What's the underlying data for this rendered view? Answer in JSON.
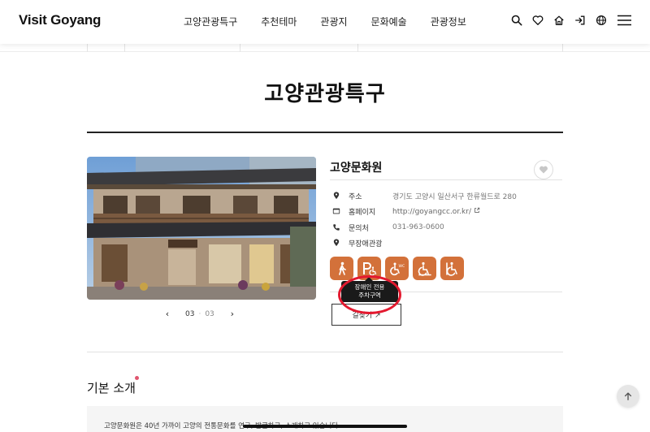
{
  "header": {
    "logo": "Visit Goyang",
    "nav": [
      "고양관광특구",
      "추천테마",
      "관광지",
      "문화예술",
      "관광정보"
    ]
  },
  "icons": {
    "search": "search-icon",
    "like": "heart-icon",
    "home": "home-icon",
    "login": "login-icon",
    "language": "globe-icon",
    "menu": "hamburger-menu-icon"
  },
  "page": {
    "title": "고양관광특구"
  },
  "gallery": {
    "current": "03",
    "total": "03",
    "prev_icon": "chevron-left-icon",
    "next_icon": "chevron-right-icon"
  },
  "place": {
    "name": "고양문화원",
    "rows": [
      {
        "icon": "location-pin-icon",
        "label": "주소",
        "value": "경기도 고양시 일산서구 한류월드로 280"
      },
      {
        "icon": "homepage-icon",
        "label": "홈페이지",
        "value": "http://goyangcc.or.kr/"
      },
      {
        "icon": "phone-icon",
        "label": "문의처",
        "value": "031-963-0600"
      },
      {
        "icon": "location-pin-icon",
        "label": "무장애관광",
        "value": ""
      }
    ],
    "accessibility": [
      "pedestrian-icon",
      "accessible-parking-icon",
      "accessible-restroom-icon",
      "wheelchair-icon",
      "wheelchair-access-icon"
    ],
    "tooltip_lines": [
      "장애인 전용",
      "주차구역"
    ],
    "route_button": "길찾기 ↗"
  },
  "intro": {
    "heading": "기본 소개",
    "text": "고양문화원은 40년 가까이 고양의 전통문화를 연구, 발굴하고, 소개하고 있습니다."
  },
  "colors": {
    "accent": "#d3713a",
    "highlight": "#e3192f",
    "dot": "#e0566f"
  }
}
